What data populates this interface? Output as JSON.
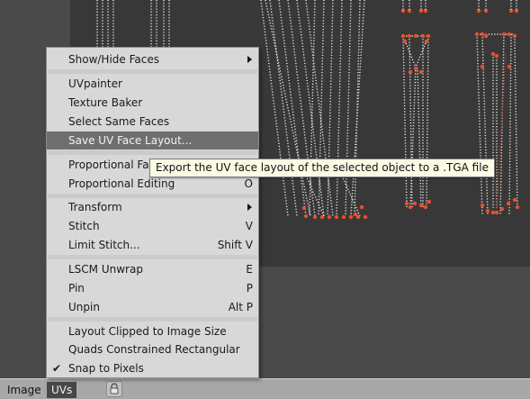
{
  "colors": {
    "accent_highlight": "#6f6f6f",
    "uv_vertex": "#e8502a",
    "uv_edge": "#e9e9e9",
    "uv_selected_edge": "#d43a2a",
    "tooltip_bg": "#fbfbe6"
  },
  "header": {
    "image_menu": "Image",
    "uvs_menu": "UVs",
    "lock_icon": "lock-icon"
  },
  "uvs_menu": {
    "items": [
      {
        "label": "Show/Hide Faces",
        "shortcut": "",
        "submenu": true,
        "highlighted": false,
        "checked": false
      },
      {
        "label": "UVpainter",
        "shortcut": "",
        "submenu": false,
        "highlighted": false,
        "checked": false
      },
      {
        "label": "Texture Baker",
        "shortcut": "",
        "submenu": false,
        "highlighted": false,
        "checked": false
      },
      {
        "label": "Select Same Faces",
        "shortcut": "",
        "submenu": false,
        "highlighted": false,
        "checked": false
      },
      {
        "label": "Save UV Face Layout...",
        "shortcut": "",
        "submenu": false,
        "highlighted": true,
        "checked": false
      },
      {
        "label": "Proportional Falloff",
        "shortcut": "",
        "submenu": false,
        "highlighted": false,
        "checked": false
      },
      {
        "label": "Proportional Editing",
        "shortcut": "O",
        "submenu": false,
        "highlighted": false,
        "checked": false
      },
      {
        "label": "Transform",
        "shortcut": "",
        "submenu": true,
        "highlighted": false,
        "checked": false
      },
      {
        "label": "Stitch",
        "shortcut": "V",
        "submenu": false,
        "highlighted": false,
        "checked": false
      },
      {
        "label": "Limit Stitch...",
        "shortcut": "Shift V",
        "submenu": false,
        "highlighted": false,
        "checked": false
      },
      {
        "label": "LSCM Unwrap",
        "shortcut": "E",
        "submenu": false,
        "highlighted": false,
        "checked": false
      },
      {
        "label": "Pin",
        "shortcut": "P",
        "submenu": false,
        "highlighted": false,
        "checked": false
      },
      {
        "label": "Unpin",
        "shortcut": "Alt P",
        "submenu": false,
        "highlighted": false,
        "checked": false
      },
      {
        "label": "Layout Clipped to Image Size",
        "shortcut": "",
        "submenu": false,
        "highlighted": false,
        "checked": false
      },
      {
        "label": "Quads Constrained Rectangular",
        "shortcut": "",
        "submenu": false,
        "highlighted": false,
        "checked": false
      },
      {
        "label": "Snap to Pixels",
        "shortcut": "",
        "submenu": false,
        "highlighted": false,
        "checked": true
      }
    ]
  },
  "tooltip": {
    "text": "Export the UV face layout of the selected object to a .TGA file"
  }
}
